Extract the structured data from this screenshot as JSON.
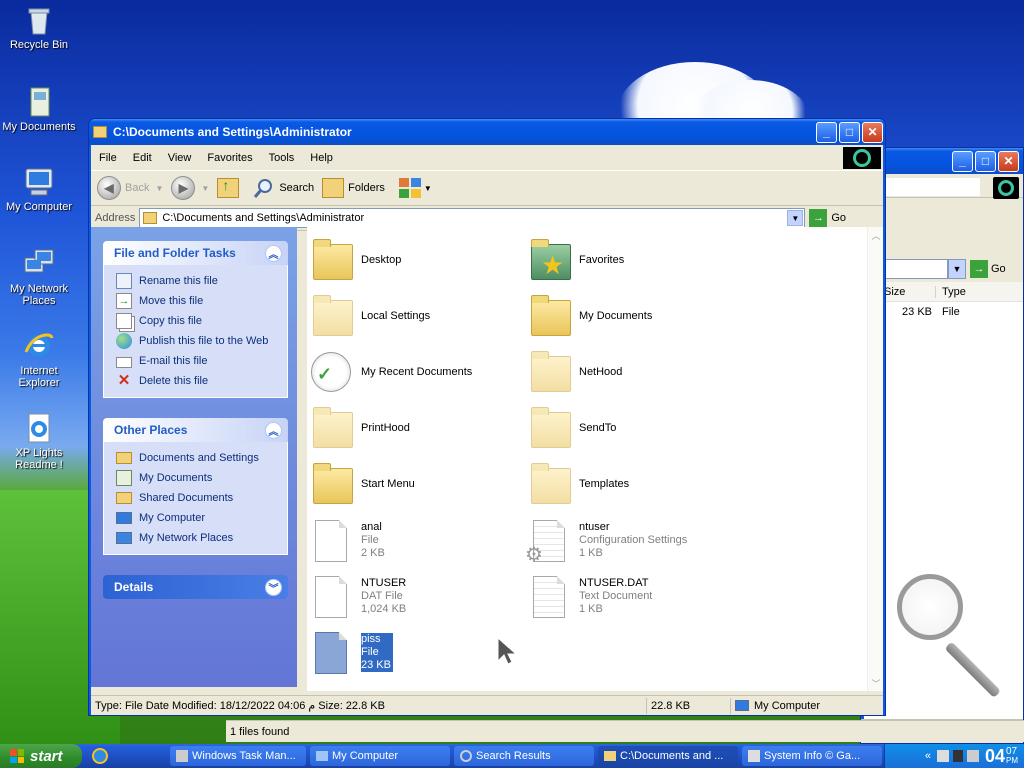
{
  "desktop": {
    "icons": [
      {
        "label": "Recycle Bin"
      },
      {
        "label": "My Documents"
      },
      {
        "label": "My Computer"
      },
      {
        "label": "My Network Places"
      },
      {
        "label": "Internet Explorer"
      },
      {
        "label": "XP Lights Readme !"
      }
    ]
  },
  "bg_window": {
    "go_label": "Go",
    "col_size": "Size",
    "col_type": "Type",
    "row_size": "23 KB",
    "row_type": "File",
    "status": "1 files found"
  },
  "window": {
    "title": "C:\\Documents and Settings\\Administrator",
    "menu": [
      "File",
      "Edit",
      "View",
      "Favorites",
      "Tools",
      "Help"
    ],
    "toolbar": {
      "back": "Back",
      "search": "Search",
      "folders": "Folders"
    },
    "address": {
      "label": "Address",
      "value": "C:\\Documents and Settings\\Administrator",
      "go": "Go"
    },
    "file_tasks": {
      "title": "File and Folder Tasks",
      "items": [
        "Rename this file",
        "Move this file",
        "Copy this file",
        "Publish this file to the Web",
        "E-mail this file",
        "Delete this file"
      ]
    },
    "other_places": {
      "title": "Other Places",
      "items": [
        "Documents and Settings",
        "My Documents",
        "Shared Documents",
        "My Computer",
        "My Network Places"
      ]
    },
    "details": {
      "title": "Details"
    },
    "files": [
      {
        "name": "Desktop",
        "line2": "",
        "line3": ""
      },
      {
        "name": "Favorites",
        "line2": "",
        "line3": ""
      },
      {
        "name": "Local Settings",
        "line2": "",
        "line3": ""
      },
      {
        "name": "My Documents",
        "line2": "",
        "line3": ""
      },
      {
        "name": "My Recent Documents",
        "line2": "",
        "line3": ""
      },
      {
        "name": "NetHood",
        "line2": "",
        "line3": ""
      },
      {
        "name": "PrintHood",
        "line2": "",
        "line3": ""
      },
      {
        "name": "SendTo",
        "line2": "",
        "line3": ""
      },
      {
        "name": "Start Menu",
        "line2": "",
        "line3": ""
      },
      {
        "name": "Templates",
        "line2": "",
        "line3": ""
      },
      {
        "name": "anal",
        "line2": "File",
        "line3": "2 KB"
      },
      {
        "name": "ntuser",
        "line2": "Configuration Settings",
        "line3": "1 KB"
      },
      {
        "name": "NTUSER",
        "line2": "DAT File",
        "line3": "1,024 KB"
      },
      {
        "name": "NTUSER.DAT",
        "line2": "Text Document",
        "line3": "1 KB"
      },
      {
        "name": "piss",
        "line2": "File",
        "line3": "23 KB"
      }
    ],
    "status": {
      "info": "Type: File Date Modified: 18/12/2022 04:06 م Size: 22.8 KB",
      "size": "22.8 KB",
      "location": "My Computer"
    }
  },
  "taskbar": {
    "start": "start",
    "tasks": [
      "Windows Task Man...",
      "My Computer",
      "Search Results",
      "C:\\Documents and ...",
      "System Info © Ga..."
    ],
    "clock_hour": "04",
    "clock_min": "07",
    "clock_ampm": "PM"
  },
  "colors": {
    "xp_blue": "#0a5be0",
    "task_pane": "#6375d6",
    "selection": "#316ac5"
  }
}
